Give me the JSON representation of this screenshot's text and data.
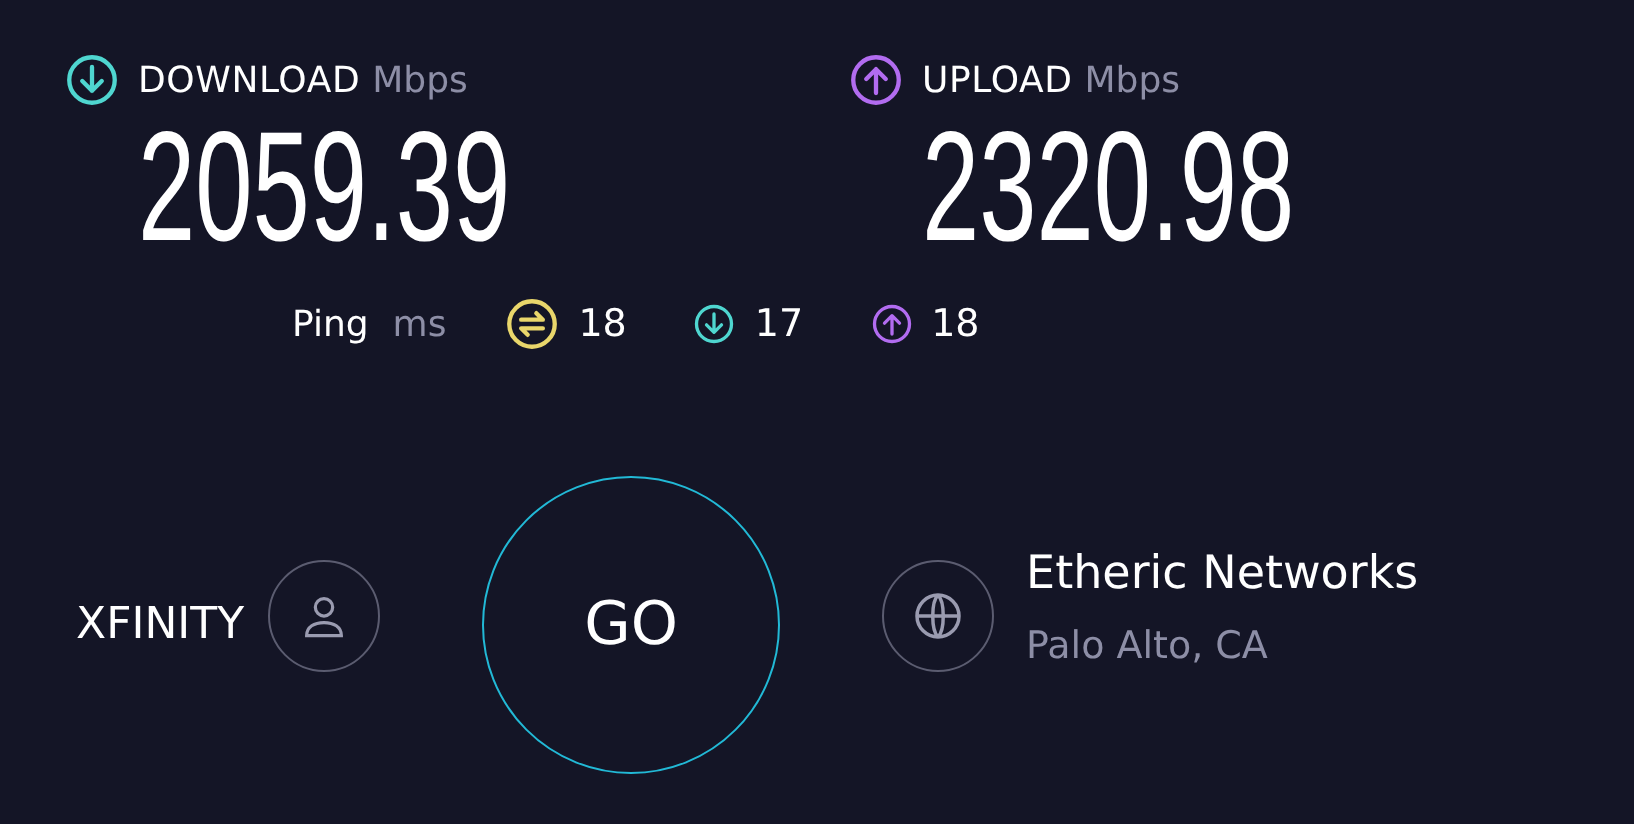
{
  "download": {
    "label": "DOWNLOAD",
    "unit": "Mbps",
    "value": "2059.39"
  },
  "upload": {
    "label": "UPLOAD",
    "unit": "Mbps",
    "value": "2320.98"
  },
  "ping": {
    "label": "Ping",
    "unit": "ms",
    "readings": [
      {
        "kind": "idle",
        "value": "18"
      },
      {
        "kind": "download",
        "value": "17"
      },
      {
        "kind": "upload",
        "value": "18"
      }
    ]
  },
  "provider": {
    "name": "XFINITY"
  },
  "go": {
    "label": "GO"
  },
  "server": {
    "name": "Etheric Networks",
    "location": "Palo Alto, CA"
  }
}
